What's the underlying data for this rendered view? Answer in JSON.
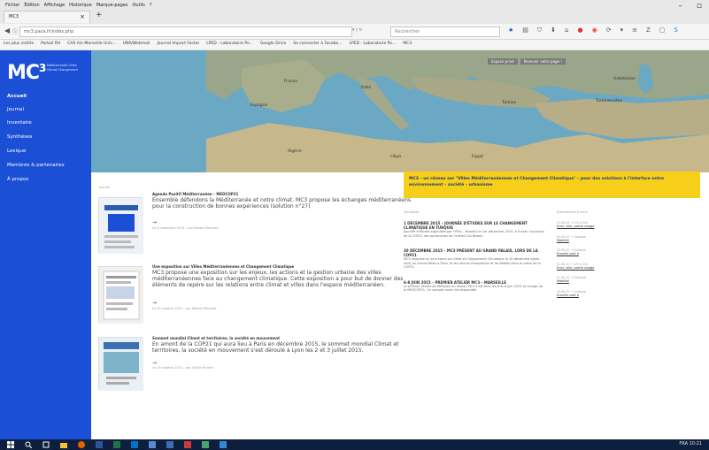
{
  "browser": {
    "menus": [
      "Fichier",
      "Édition",
      "Affichage",
      "Historique",
      "Marque-pages",
      "Outils",
      "?"
    ],
    "tab_title": "MC3",
    "tab_close": "×",
    "new_tab": "+",
    "url": "mc3.paca.fr/index.php",
    "search_placeholder": "Rechercher",
    "bookmarks": [
      "Les plus visités",
      "Portail RH",
      "CAS Aix-Marseille Univ...",
      "UNIVWebmail",
      "Journal Impact Factor",
      "LPED - Laboratoire Po...",
      "Google Drive",
      "Se connecter à Facebo...",
      "LPED - Laboratoire Po...",
      "MC3"
    ]
  },
  "site": {
    "logo_text": "MC",
    "logo_sup": "3",
    "tagline": "Méditerranée Villes Climat Changement",
    "nav": [
      {
        "label": "Accueil"
      },
      {
        "label": "Journal"
      },
      {
        "label": "Inventaire"
      },
      {
        "label": "Synthèses"
      },
      {
        "label": "Lexique"
      },
      {
        "label": "Membres & partenaires"
      },
      {
        "label": "À propos"
      }
    ],
    "map_buttons": [
      "Espace privé",
      "Recevoir notre page !"
    ],
    "map_labels": {
      "france": "France",
      "spain": "Espagne",
      "italy": "Italie",
      "turkey": "Türkiye",
      "algeria": "Algérie",
      "libya": "Libya",
      "egypt": "Egypt",
      "turkmenistan": "Turkmenistan",
      "uzbekistan": "Uzbekistan"
    },
    "banner": "MC3 – un réseau sur \"Villes Méditerranéennes et Changement Climatique\" – pour des solutions à l'interface entre environnement – société – urbanisme",
    "section_label": "Journal",
    "articles": [
      {
        "title": "Agenda Positif Méditerranéen – MEDCOP21",
        "text": "Ensemble défendons la Méditerranée et notre climat. MC3 propose les échanges méditerranéens pour la construction de bonnes expériences (solution n°27)",
        "more": "→",
        "meta": "Le 3 novembre 2015 – par Robert Mazurek"
      },
      {
        "title": "Une exposition sur Villes Méditerranéennes et Changement Climatique",
        "text": "MC3 propose une exposition sur les enjeux, les actions et la gestion urbaine des villes méditerranéennes face au changement climatique. Cette exposition a pour but de donner des éléments de repère sur les relations entre climat et villes dans l'espace méditerranéen.",
        "more": "→",
        "meta": "Le 30 octobre 2015 – par Robert Mazurek"
      },
      {
        "title": "Sommet mondial Climat et territoires, la société en mouvement",
        "text": "En amont de la COP21 qui aura lieu à Paris en décembre 2015, le sommet mondial Climat et territoires, la société en mouvement s'est déroulé à Lyon les 2 et 3 juillet 2015.",
        "more": "→",
        "meta": "Le 19 octobre 2015 – par Cécile Rivière"
      }
    ],
    "news_label": "Actualités",
    "news": [
      {
        "title": "1 DÉCEMBRE 2015 – JOURNÉE D'ÉTUDES SUR LE CHANGEMENT CLIMATIQUE EN TURQUIE",
        "text": "Journée d'études organisée par l'IFEA – Istanbul le 1er décembre 2015, à 9 avec l'occasion de la COP21 des partenaires de l'Institut Du Bassin."
      },
      {
        "title": "30 DÉCEMBRE 2015 – MC3 PRÉSENT AU GRAND PALAIS, LORS DE LA COP21",
        "text": "MC3 organise un seul stand sur Villes et Changement Climatique le 30 décembre après-midi, au Grand Palais à Paris, et les heures d'exposition et de débats dans le cadre de la COP21."
      },
      {
        "title": "6-8 JUIN 2015 – PREMIER ATELIER MC3 – MARSEILLE",
        "text": "Le premier atelier de réflexion du réseau MC3 s'est tenu les 6 et 8 juin 2015 en marge de la MEDCOP21. Un compte rendu est disponible."
      }
    ],
    "agenda_label": "Événements à venir",
    "agenda": [
      {
        "date": "01.06.15 → 17h à 22h",
        "link": "Enet, ville, partie visage"
      },
      {
        "date": "01.06.15 → Colloque",
        "link": "Mobilité"
      },
      {
        "date": "10.06.15 → Colloque",
        "link": "Ecoville part e"
      },
      {
        "date": "01.06.15 → 17h à 22h",
        "link": "Enet, ville, partie visage"
      },
      {
        "date": "01.06.15 → Colloque",
        "link": "Mobilité"
      },
      {
        "date": "10.06.15 → Colloque",
        "link": "Ecoville part e"
      }
    ],
    "tray_text": "FRA  10:21"
  },
  "colors": {
    "sidebar": "#1b50d6",
    "banner": "#f7cf1a",
    "map_sea": "#6aa8c4",
    "taskbar": "#0e1f3d"
  }
}
